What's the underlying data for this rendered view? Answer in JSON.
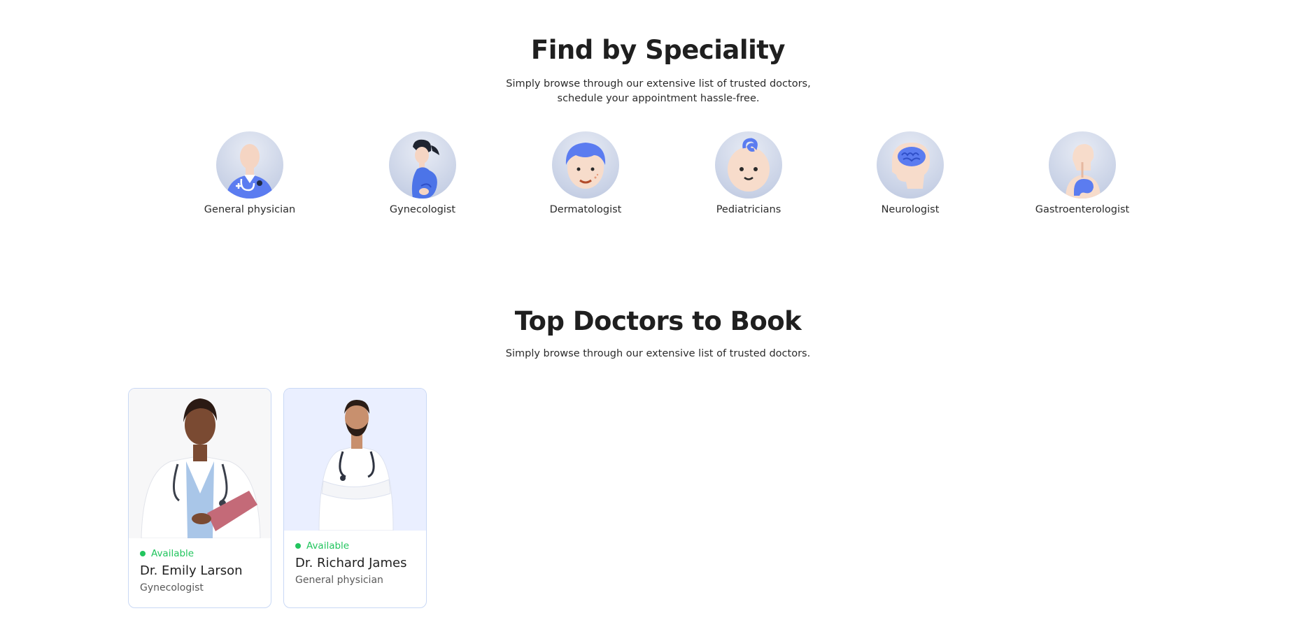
{
  "speciality": {
    "title": "Find by Speciality",
    "subtitle": "Simply browse through our extensive list of trusted doctors, schedule your appointment hassle-free.",
    "items": [
      {
        "label": "General physician",
        "icon": "general-physician-icon"
      },
      {
        "label": "Gynecologist",
        "icon": "gynecologist-icon"
      },
      {
        "label": "Dermatologist",
        "icon": "dermatologist-icon"
      },
      {
        "label": "Pediatricians",
        "icon": "pediatrician-icon"
      },
      {
        "label": "Neurologist",
        "icon": "neurologist-icon"
      },
      {
        "label": "Gastroenterologist",
        "icon": "gastroenterologist-icon"
      }
    ]
  },
  "top_doctors": {
    "title": "Top Doctors to Book",
    "subtitle": "Simply browse through our extensive list of trusted doctors.",
    "doctors": [
      {
        "status": "Available",
        "name": "Dr. Emily Larson",
        "speciality": "Gynecologist"
      },
      {
        "status": "Available",
        "name": "Dr. Richard James",
        "speciality": "General physician"
      }
    ]
  },
  "colors": {
    "accent": "#5f6fff",
    "available": "#22c55e",
    "card_border": "#c9d8f5",
    "photo_bg_alt": "#eaefff"
  }
}
